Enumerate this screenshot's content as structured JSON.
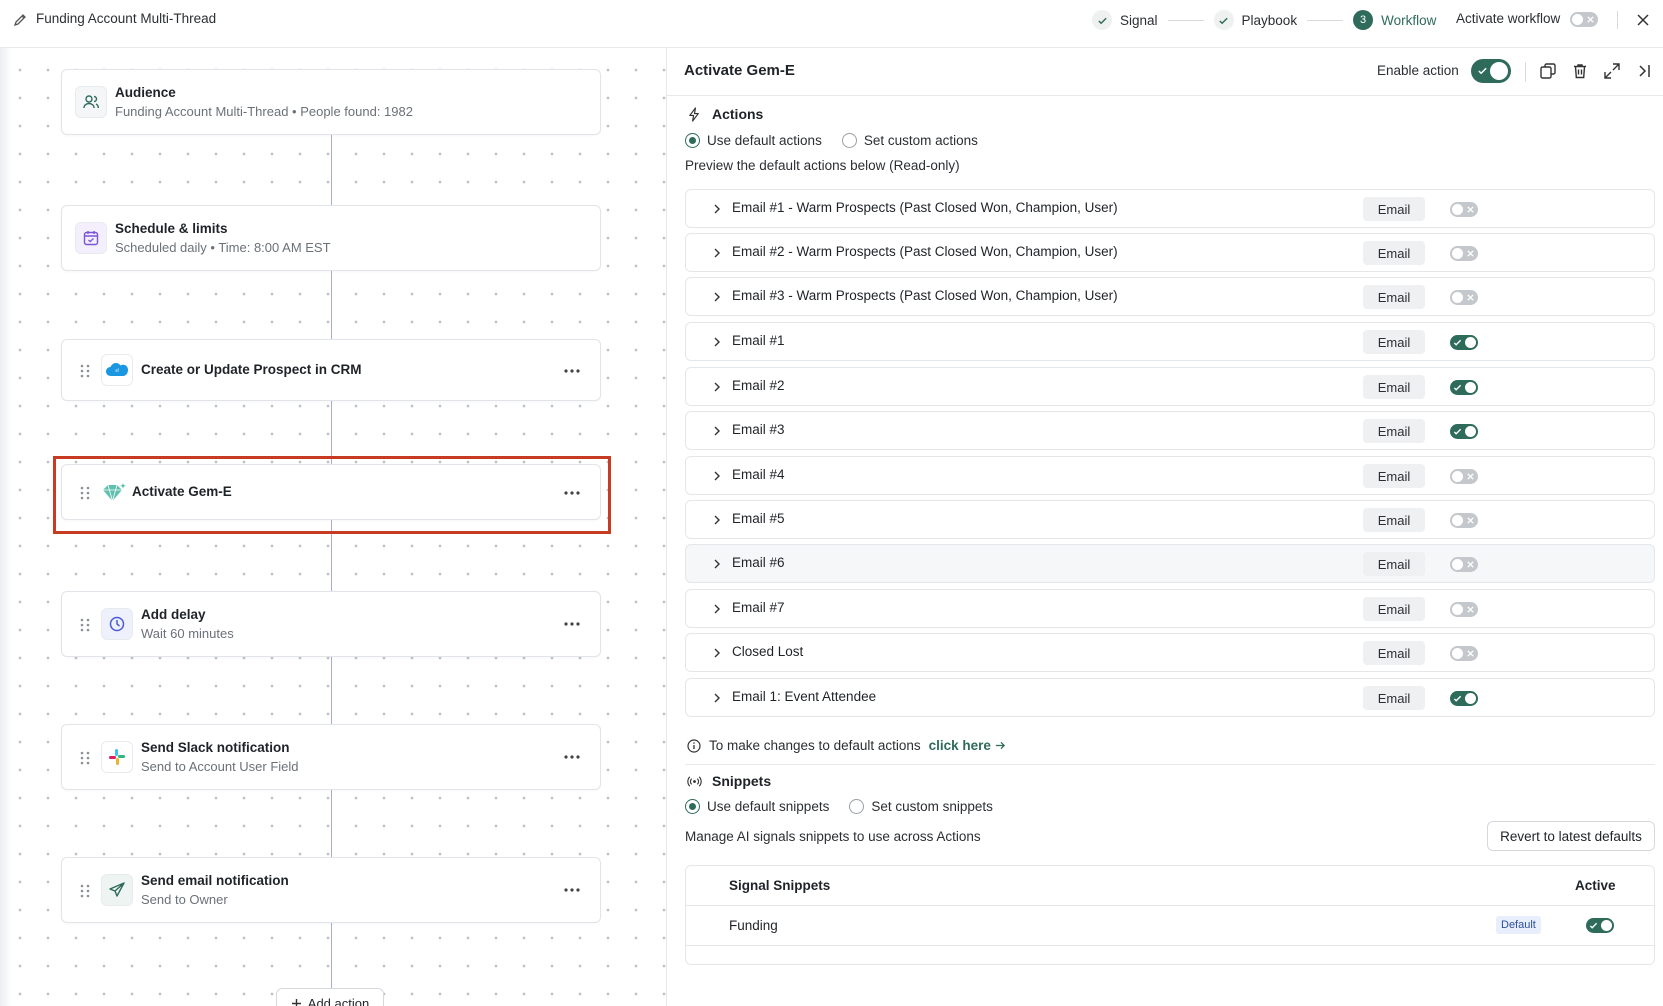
{
  "topbar": {
    "workflow_title": "Funding Account Multi-Thread",
    "steps": [
      {
        "label": "Signal",
        "state": "done"
      },
      {
        "label": "Playbook",
        "state": "done"
      },
      {
        "label": "Workflow",
        "number": "3",
        "state": "current"
      }
    ],
    "activate_label": "Activate workflow",
    "activate_on": false
  },
  "canvas": {
    "nodes": [
      {
        "title": "Audience",
        "subtitle": "Funding Account Multi-Thread • People found: 1982",
        "icon": "users-icon"
      },
      {
        "title": "Schedule & limits",
        "subtitle": "Scheduled daily • Time: 8:00 AM EST",
        "icon": "calendar-icon"
      },
      {
        "title": "Create or Update Prospect in CRM",
        "subtitle": "",
        "icon": "salesforce-icon"
      },
      {
        "title": "Activate Gem-E",
        "subtitle": "",
        "icon": "gem-sparkle-icon"
      },
      {
        "title": "Add delay",
        "subtitle": "Wait 60 minutes",
        "icon": "clock-icon"
      },
      {
        "title": "Send Slack notification",
        "subtitle": "Send to Account User Field",
        "icon": "slack-icon"
      },
      {
        "title": "Send email notification",
        "subtitle": "Send to Owner",
        "icon": "send-icon"
      }
    ],
    "add_action_label": "Add action"
  },
  "panel": {
    "title": "Activate Gem-E",
    "enable_label": "Enable action",
    "enabled": true,
    "actions_heading": "Actions",
    "actions_radio": {
      "default": "Use default actions",
      "custom": "Set custom actions",
      "selected": "default"
    },
    "preview_note": "Preview the default actions below (Read-only)",
    "actions": [
      {
        "label": "Email #1 - Warm Prospects (Past Closed Won, Champion, User)",
        "type": "Email",
        "on": false
      },
      {
        "label": "Email #2 - Warm Prospects (Past Closed Won, Champion, User)",
        "type": "Email",
        "on": false
      },
      {
        "label": "Email #3 - Warm Prospects (Past Closed Won, Champion, User)",
        "type": "Email",
        "on": false
      },
      {
        "label": "Email #1",
        "type": "Email",
        "on": true
      },
      {
        "label": "Email #2",
        "type": "Email",
        "on": true
      },
      {
        "label": "Email #3",
        "type": "Email",
        "on": true
      },
      {
        "label": "Email #4",
        "type": "Email",
        "on": false
      },
      {
        "label": "Email #5",
        "type": "Email",
        "on": false
      },
      {
        "label": "Email #6",
        "type": "Email",
        "on": false
      },
      {
        "label": "Email #7",
        "type": "Email",
        "on": false
      },
      {
        "label": "Closed Lost",
        "type": "Email",
        "on": false
      },
      {
        "label": "Email 1: Event Attendee",
        "type": "Email",
        "on": true
      }
    ],
    "info_text": "To make changes to default actions",
    "info_link": "click here",
    "snippets_heading": "Snippets",
    "snippets_radio": {
      "default": "Use default snippets",
      "custom": "Set custom snippets",
      "selected": "default"
    },
    "manage_note": "Manage AI signals snippets to use across Actions",
    "revert_label": "Revert to latest defaults",
    "snippet_table": {
      "col_name": "Signal Snippets",
      "col_active": "Active",
      "rows": [
        {
          "name": "Funding",
          "badge": "Default",
          "active": true
        }
      ]
    }
  },
  "colors": {
    "accent": "#2f6b5b",
    "highlight": "#c63b22",
    "connector": "#a7acd8"
  }
}
